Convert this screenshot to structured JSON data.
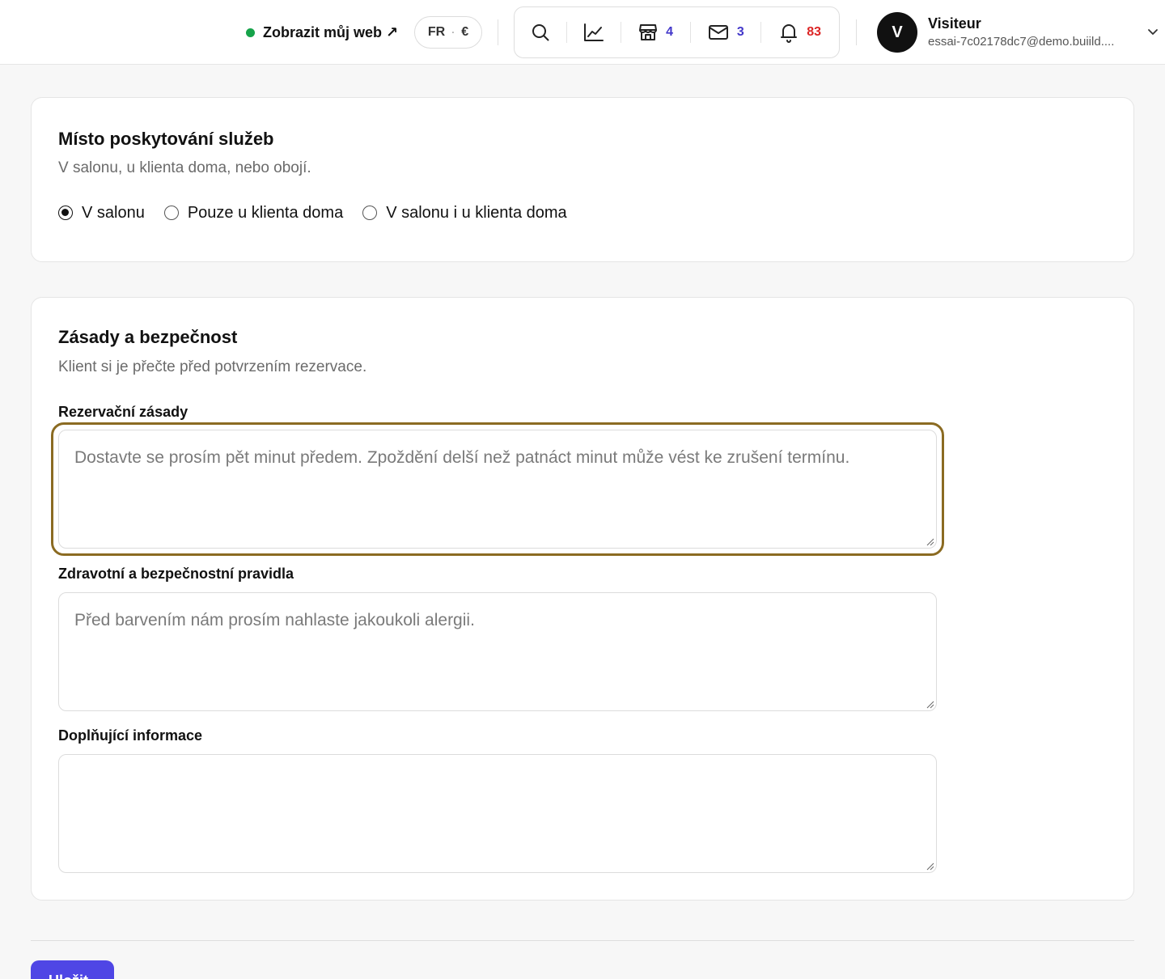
{
  "topbar": {
    "view_site_label": "Zobrazit můj web ↗",
    "locale_lang": "FR",
    "locale_sep": "·",
    "locale_currency": "€",
    "shop_count": "4",
    "mail_count": "3",
    "notif_count": "83",
    "user_initial": "V",
    "user_name": "Visiteur",
    "user_email": "essai-7c02178dc7@demo.buiild...."
  },
  "service_location": {
    "title": "Místo poskytování služeb",
    "subtitle": "V salonu, u klienta doma, nebo obojí.",
    "options": [
      {
        "label": "V salonu",
        "checked": true
      },
      {
        "label": "Pouze u klienta doma",
        "checked": false
      },
      {
        "label": "V salonu i u klienta doma",
        "checked": false
      }
    ]
  },
  "policies": {
    "title": "Zásady a bezpečnost",
    "subtitle": "Klient si je přečte před potvrzením rezervace.",
    "booking_label": "Rezervační zásady",
    "booking_placeholder": "Dostavte se prosím pět minut předem. Zpoždění delší než patnáct minut může vést ke zrušení termínu.",
    "health_label": "Zdravotní a bezpečnostní pravidla",
    "health_placeholder": "Před barvením nám prosím nahlaste jakoukoli alergii.",
    "extra_label": "Doplňující informace",
    "extra_placeholder": ""
  },
  "submit_label": "Uložit",
  "colors": {
    "accent": "#4f46e5",
    "focus_ring": "#8b6b22",
    "online_dot": "#16a34a",
    "badge_blue": "#4338ca",
    "badge_red": "#dc2626"
  },
  "icons": [
    "search-icon",
    "chart-icon",
    "store-icon",
    "mail-icon",
    "bell-icon",
    "chevron-down-icon"
  ]
}
